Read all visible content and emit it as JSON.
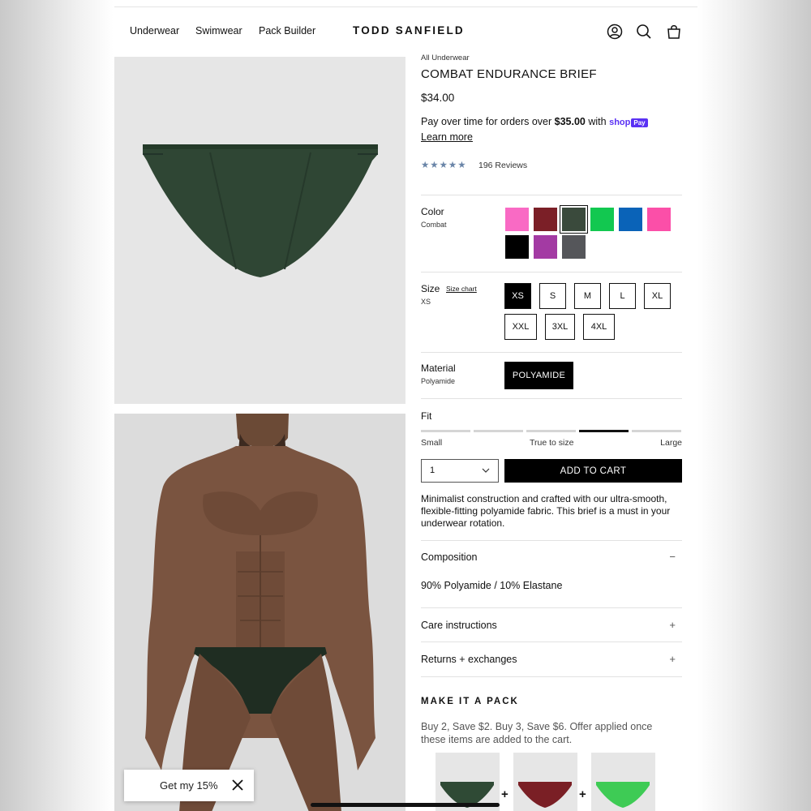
{
  "header": {
    "nav": [
      "Underwear",
      "Swimwear",
      "Pack Builder"
    ],
    "brand": "TODD SANFIELD",
    "icons": [
      "account-icon",
      "search-icon",
      "cart-icon"
    ]
  },
  "product": {
    "breadcrumb": "All Underwear",
    "title": "COMBAT ENDURANCE BRIEF",
    "price": "$34.00",
    "pay_prefix": "Pay over time for orders over ",
    "pay_amount": "$35.00",
    "pay_suffix": " with ",
    "shop_label": "shop",
    "pay_badge": "Pay",
    "learn_more": "Learn more",
    "stars": "★★★★★",
    "rating": 5,
    "reviews": "196 Reviews"
  },
  "color": {
    "label": "Color",
    "selected": "Combat",
    "swatches": [
      "#f96ac4",
      "#7b1f27",
      "#3a4a3c",
      "#12c850",
      "#0a63b8",
      "#fb4fa8",
      "#000000",
      "#a33aa3",
      "#55565a"
    ],
    "selected_index": 2
  },
  "size": {
    "label": "Size",
    "chart_link": "Size chart",
    "selected": "XS",
    "options": [
      "XS",
      "S",
      "M",
      "L",
      "XL",
      "XXL",
      "3XL",
      "4XL"
    ]
  },
  "material": {
    "label": "Material",
    "selected": "Polyamide",
    "option": "POLYAMIDE"
  },
  "fit": {
    "label": "Fit",
    "low": "Small",
    "mid": "True to size",
    "high": "Large",
    "active_segment": 4,
    "segments": 5
  },
  "purchase": {
    "quantity": "1",
    "add_to_cart": "ADD TO CART"
  },
  "description": "Minimalist construction and crafted with our ultra-smooth, flexible-fitting polyamide fabric. This brief is a must in your underwear rotation.",
  "accordion": [
    {
      "title": "Composition",
      "sign": "−",
      "body": "90% Polyamide / 10% Elastane"
    },
    {
      "title": "Care instructions",
      "sign": "+"
    },
    {
      "title": "Returns + exchanges",
      "sign": "+"
    }
  ],
  "pack": {
    "title": "MAKE IT A PACK",
    "text": "Buy 2, Save $2. Buy 3, Save $6. Offer applied once these items are added to the cart.",
    "items": [
      "#2f4a35",
      "#7a1f25",
      "#3ecb55"
    ],
    "plus": "+"
  },
  "promo": {
    "text": "Get my 15%"
  },
  "colors": {
    "text": "#111111",
    "brief": "#2f4634",
    "shoppay": "#5a31f4",
    "stars": "#6a85a8"
  }
}
